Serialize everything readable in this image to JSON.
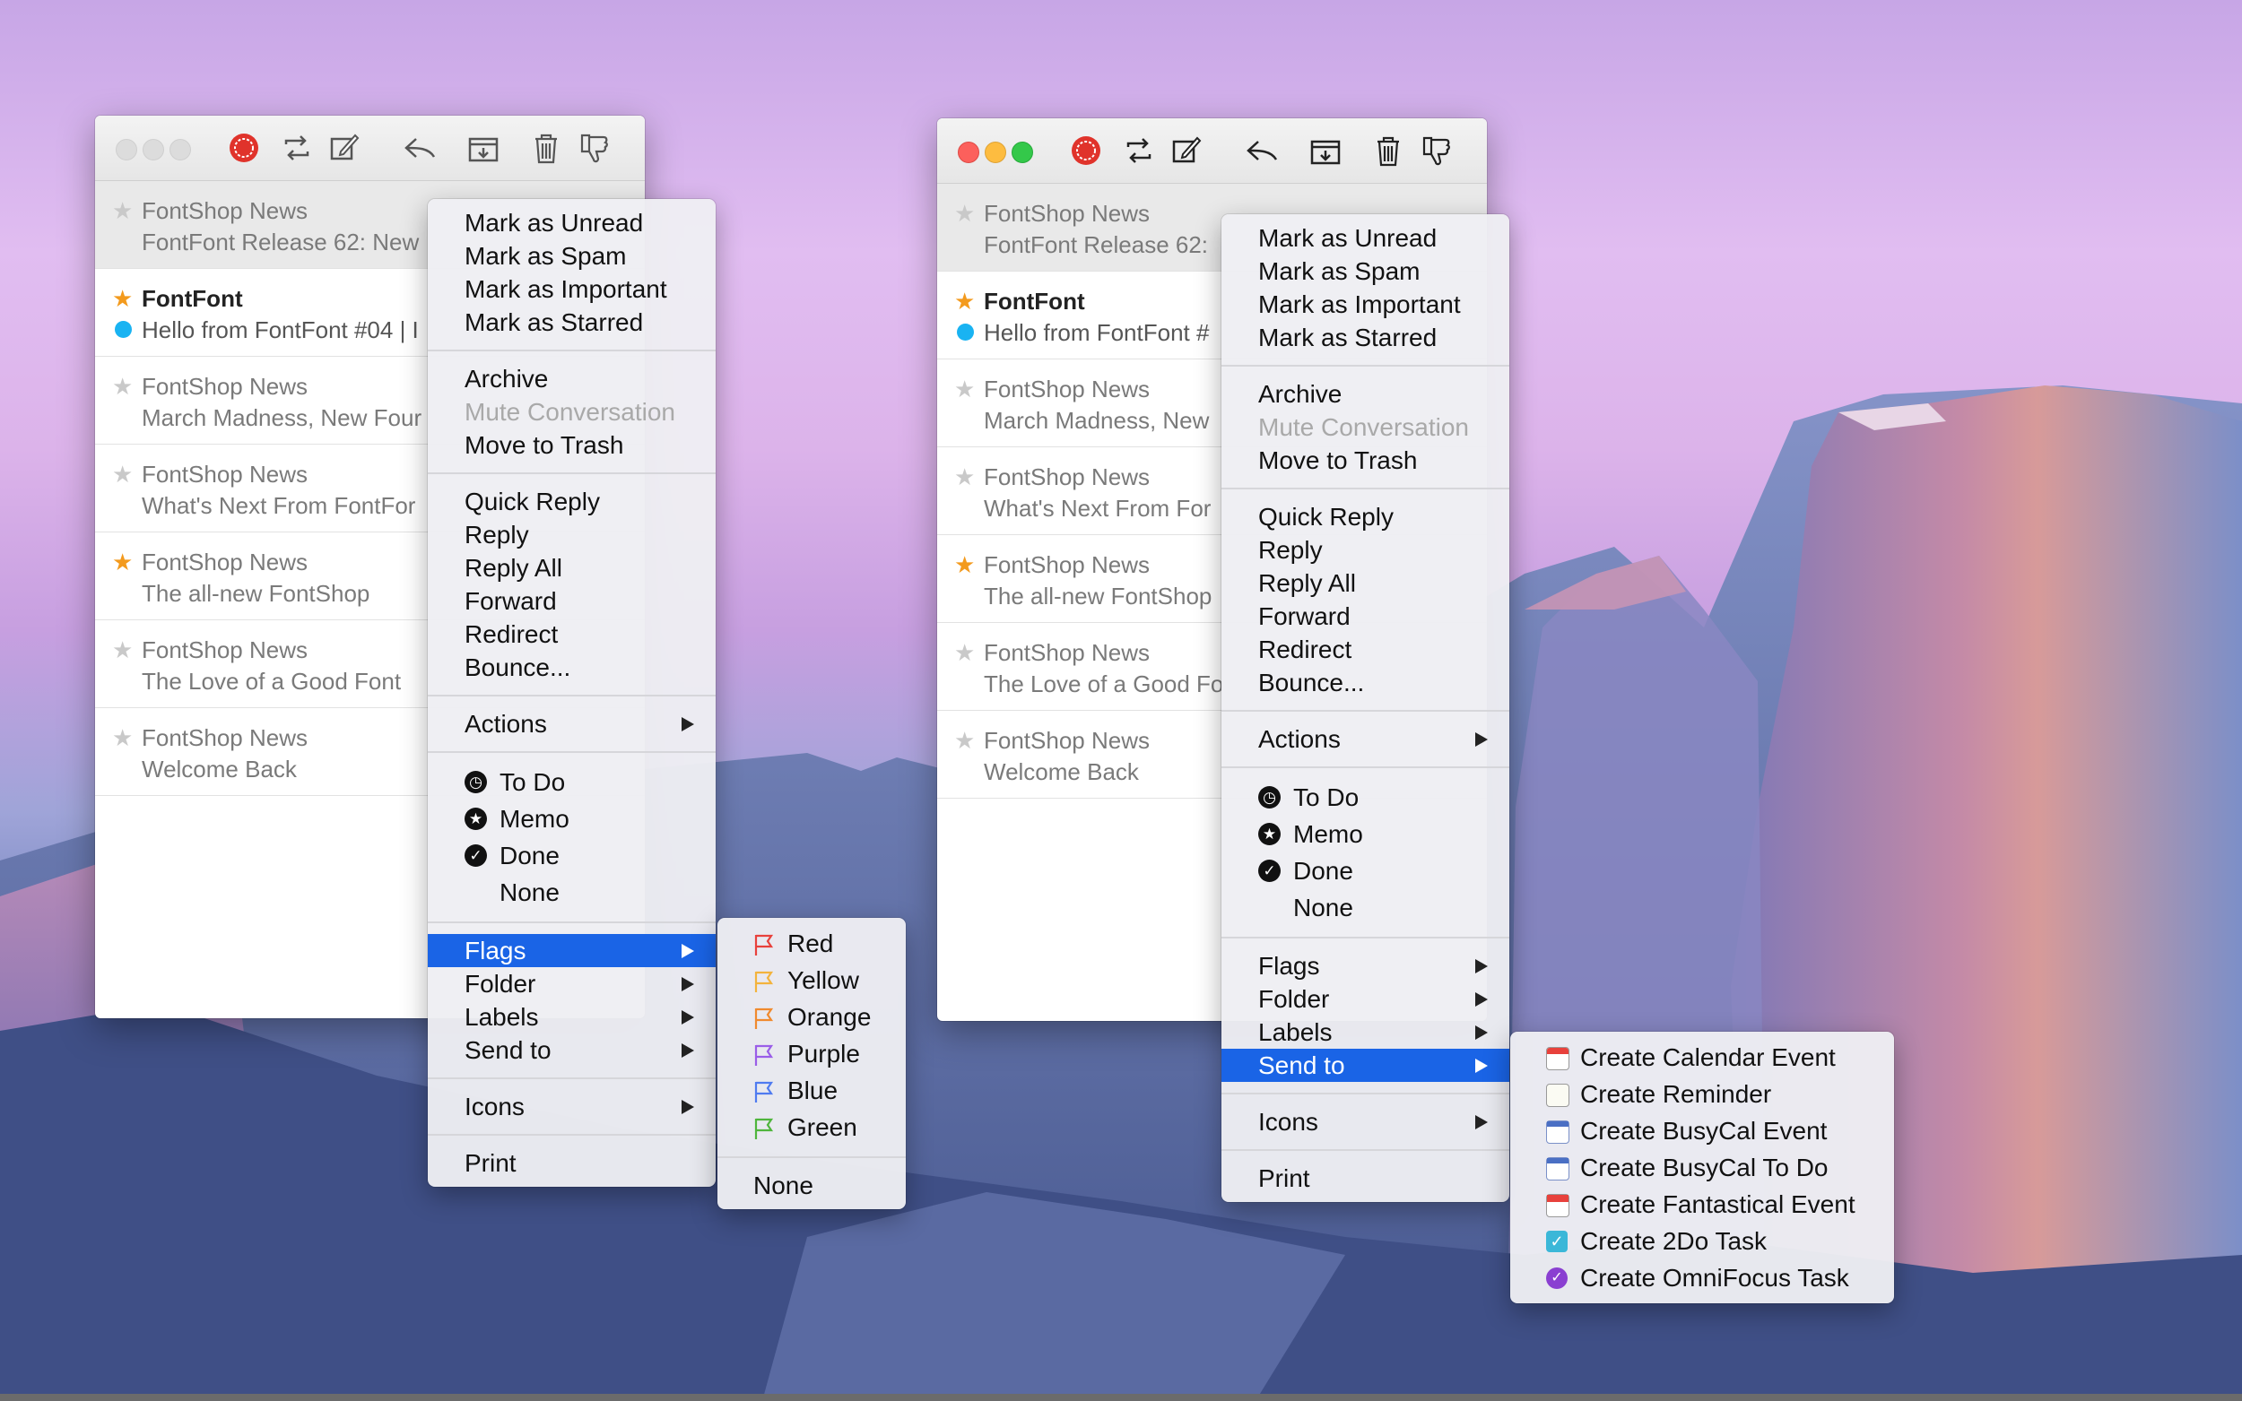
{
  "colors": {
    "menu_highlight": "#1a64e6",
    "star_on": "#f39a1d",
    "unread_dot": "#19b3f2",
    "flag_red": "#e8413c",
    "flag_yellow": "#f3b33d",
    "flag_orange": "#f08a2e",
    "flag_purple": "#9a5ee8",
    "flag_blue": "#4f7bf0",
    "flag_green": "#4fb53c"
  },
  "messages": [
    {
      "sender": "FontShop News",
      "subject": "FontFont Release 62: New",
      "starred": false,
      "unread": false
    },
    {
      "sender": "FontFont",
      "subject": "Hello from FontFont #04 | I",
      "starred": true,
      "unread": true
    },
    {
      "sender": "FontShop News",
      "subject": "March Madness, New Four",
      "starred": false,
      "unread": false
    },
    {
      "sender": "FontShop News",
      "subject": "What's Next From FontFor",
      "starred": false,
      "unread": false
    },
    {
      "sender": "FontShop News",
      "subject": "The all-new FontShop",
      "starred": true,
      "unread": false
    },
    {
      "sender": "FontShop News",
      "subject": "The Love of a Good Font",
      "starred": false,
      "unread": false
    },
    {
      "sender": "FontShop News",
      "subject": "Welcome Back",
      "starred": false,
      "unread": false
    }
  ],
  "messages2": [
    {
      "sender": "FontShop News",
      "subject": "FontFont Release 62:"
    },
    {
      "sender": "FontFont",
      "subject": "Hello from FontFont #"
    },
    {
      "sender": "FontShop News",
      "subject": "March Madness, New"
    },
    {
      "sender": "FontShop News",
      "subject": "What's Next From For"
    },
    {
      "sender": "FontShop News",
      "subject": "The all-new FontShop"
    },
    {
      "sender": "FontShop News",
      "subject": "The Love of a Good Fo"
    },
    {
      "sender": "FontShop News",
      "subject": "Welcome Back"
    }
  ],
  "menu": {
    "mark_unread": "Mark as Unread",
    "mark_spam": "Mark as Spam",
    "mark_important": "Mark as Important",
    "mark_starred": "Mark as Starred",
    "archive": "Archive",
    "mute": "Mute Conversation",
    "trash": "Move to Trash",
    "quick_reply": "Quick Reply",
    "reply": "Reply",
    "reply_all": "Reply All",
    "forward": "Forward",
    "redirect": "Redirect",
    "bounce": "Bounce...",
    "actions": "Actions",
    "todo": "To Do",
    "memo": "Memo",
    "done": "Done",
    "none": "None",
    "flags": "Flags",
    "folder": "Folder",
    "labels": "Labels",
    "send_to": "Send to",
    "icons": "Icons",
    "print": "Print"
  },
  "flags_submenu": [
    "Red",
    "Yellow",
    "Orange",
    "Purple",
    "Blue",
    "Green",
    "None"
  ],
  "sendto_submenu": [
    "Create Calendar Event",
    "Create Reminder",
    "Create BusyCal Event",
    "Create BusyCal To Do",
    "Create Fantastical Event",
    "Create 2Do Task",
    "Create OmniFocus Task"
  ]
}
